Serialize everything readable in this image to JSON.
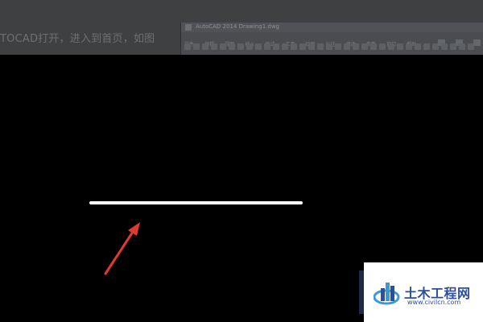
{
  "top_strip": {
    "caption_fragment": "TOCAD打开，进入到首页，如图"
  },
  "cad_window": {
    "title": "AutoCAD 2014  Drawing1.dwg",
    "menu_items": [
      "文件",
      "编辑",
      "视图",
      "插入",
      "格式",
      "工具",
      "绘图",
      "标注",
      "修改",
      "参数",
      "窗口",
      "帮助"
    ]
  },
  "canvas": {
    "background_color": "#000000",
    "line_color": "#ffffff",
    "arrow_color": "#e0392f"
  },
  "watermark": {
    "site_name_cn": "土木工程网",
    "url": "www.civilcn.com",
    "brand_color": "#2a4f9e",
    "logo_icon": "building-logo-icon"
  }
}
